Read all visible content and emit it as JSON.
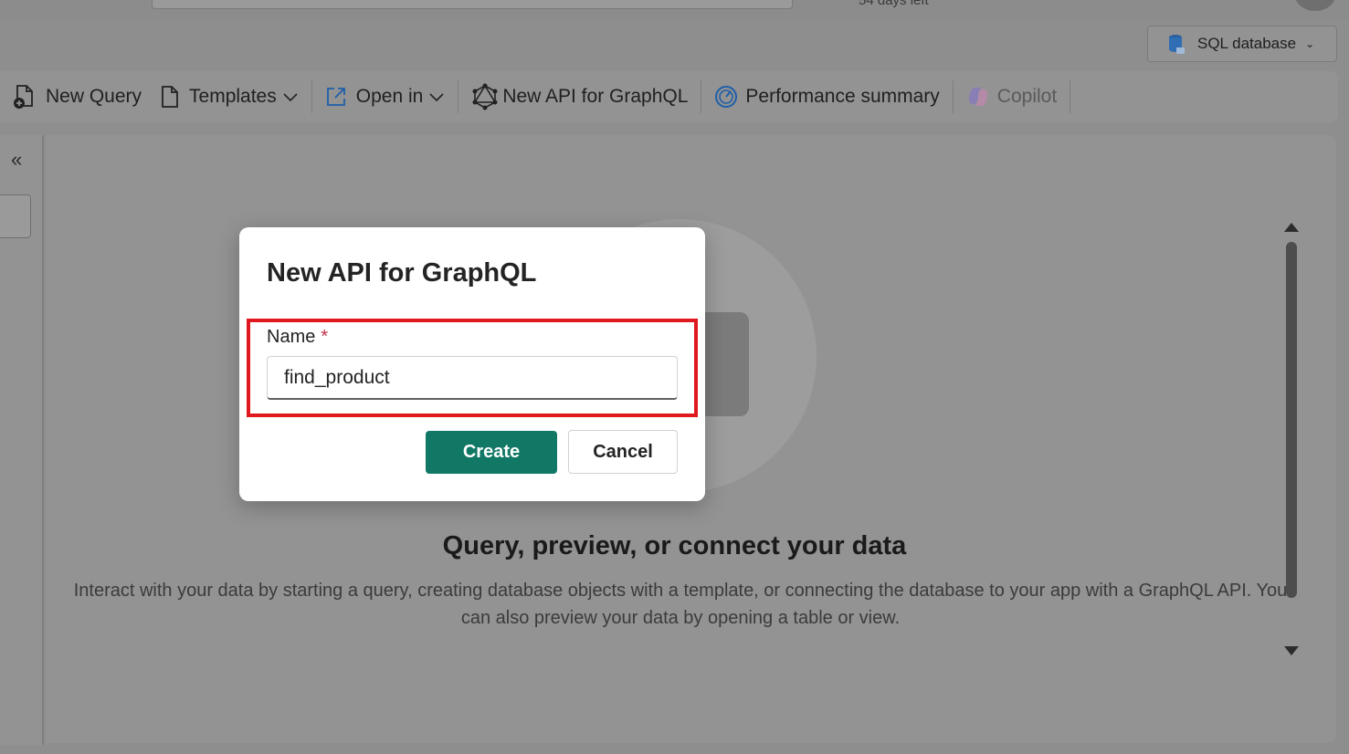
{
  "header": {
    "trial_text": "54 days left"
  },
  "db_selector": {
    "label": "SQL database",
    "icon": "sql-database-icon"
  },
  "toolbar": {
    "new_query": "New Query",
    "templates": "Templates",
    "open_in": "Open in",
    "new_api_graphql": "New API for GraphQL",
    "performance_summary": "Performance summary",
    "copilot": "Copilot"
  },
  "main": {
    "hero_title": "Query, preview, or connect your data",
    "hero_description": "Interact with your data by starting a query, creating database objects with a template, or connecting the database to your app with a GraphQL API. You can also preview your data by opening a table or view."
  },
  "dialog": {
    "title": "New API for GraphQL",
    "name_label": "Name",
    "required_marker": "*",
    "name_value": "find_product",
    "create_label": "Create",
    "cancel_label": "Cancel"
  },
  "colors": {
    "primary_button": "#117865",
    "highlight_border": "#e0191e",
    "required": "#c4314b"
  }
}
